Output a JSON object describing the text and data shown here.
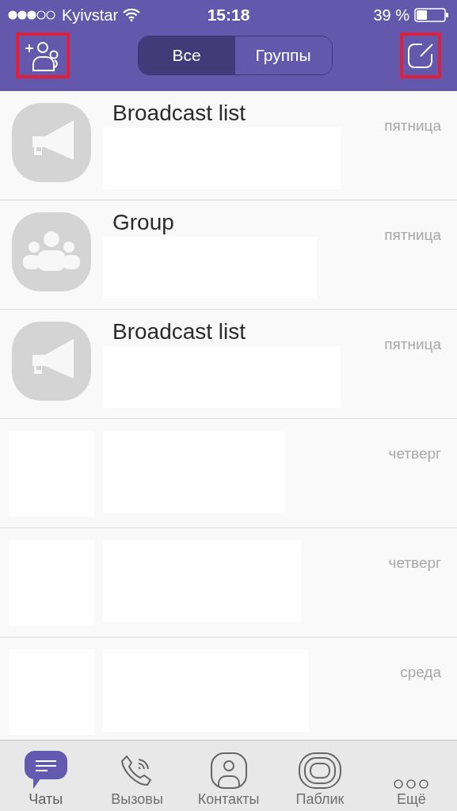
{
  "status_bar": {
    "carrier": "Kyivstar",
    "time": "15:18",
    "battery": "39 %"
  },
  "nav": {
    "left_button": {
      "highlighted": true
    },
    "segments": [
      {
        "label": "Все",
        "selected": true
      },
      {
        "label": "Группы",
        "selected": false
      }
    ],
    "right_button": {
      "highlighted": true
    }
  },
  "chats": [
    {
      "kind": "broadcast",
      "name": "Broadcast list",
      "date": "пятница"
    },
    {
      "kind": "group",
      "name": "Group",
      "date": "пятница"
    },
    {
      "kind": "broadcast",
      "name": "Broadcast list",
      "date": "пятница"
    },
    {
      "kind": "redacted",
      "date": "четверг"
    },
    {
      "kind": "redacted",
      "date": "четверг"
    },
    {
      "kind": "redacted",
      "date": "среда"
    }
  ],
  "tab_bar": [
    {
      "kind": "chats",
      "label": "Чаты",
      "selected": true
    },
    {
      "kind": "calls",
      "label": "Вызовы",
      "selected": false
    },
    {
      "kind": "contacts",
      "label": "Контакты",
      "selected": false
    },
    {
      "kind": "public",
      "label": "Паблик",
      "selected": false
    },
    {
      "kind": "more",
      "label": "Ещё",
      "selected": false
    }
  ]
}
